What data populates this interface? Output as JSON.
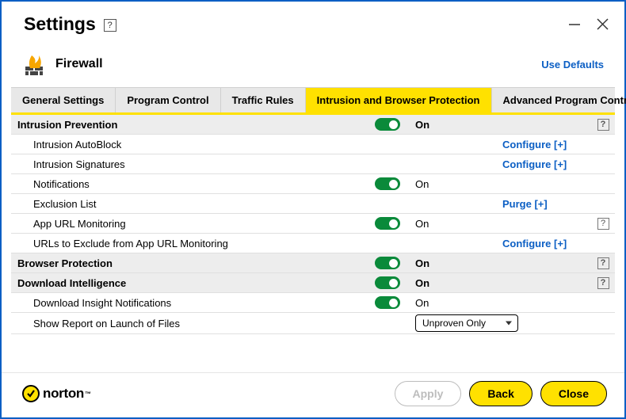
{
  "window": {
    "title": "Settings",
    "help_glyph": "?"
  },
  "section": {
    "name": "Firewall",
    "use_defaults": "Use Defaults"
  },
  "tabs": [
    "General Settings",
    "Program Control",
    "Traffic Rules",
    "Intrusion and Browser Protection",
    "Advanced Program Control"
  ],
  "rows": {
    "intrusion_prevention": {
      "label": "Intrusion Prevention",
      "status": "On"
    },
    "autoblock": {
      "label": "Intrusion AutoBlock",
      "action": "Configure [+]"
    },
    "signatures": {
      "label": "Intrusion Signatures",
      "action": "Configure [+]"
    },
    "notifications": {
      "label": "Notifications",
      "status": "On"
    },
    "exclusion_list": {
      "label": "Exclusion List",
      "action": "Purge [+]"
    },
    "app_url": {
      "label": "App URL Monitoring",
      "status": "On"
    },
    "urls_exclude": {
      "label": "URLs to Exclude from App URL Monitoring",
      "action": "Configure [+]"
    },
    "browser_protection": {
      "label": "Browser Protection",
      "status": "On"
    },
    "download_intel": {
      "label": "Download Intelligence",
      "status": "On"
    },
    "download_notif": {
      "label": "Download Insight Notifications",
      "status": "On"
    },
    "show_report": {
      "label": "Show Report on Launch of Files",
      "select_value": "Unproven Only"
    }
  },
  "footer": {
    "brand": "norton",
    "apply": "Apply",
    "back": "Back",
    "close": "Close"
  }
}
